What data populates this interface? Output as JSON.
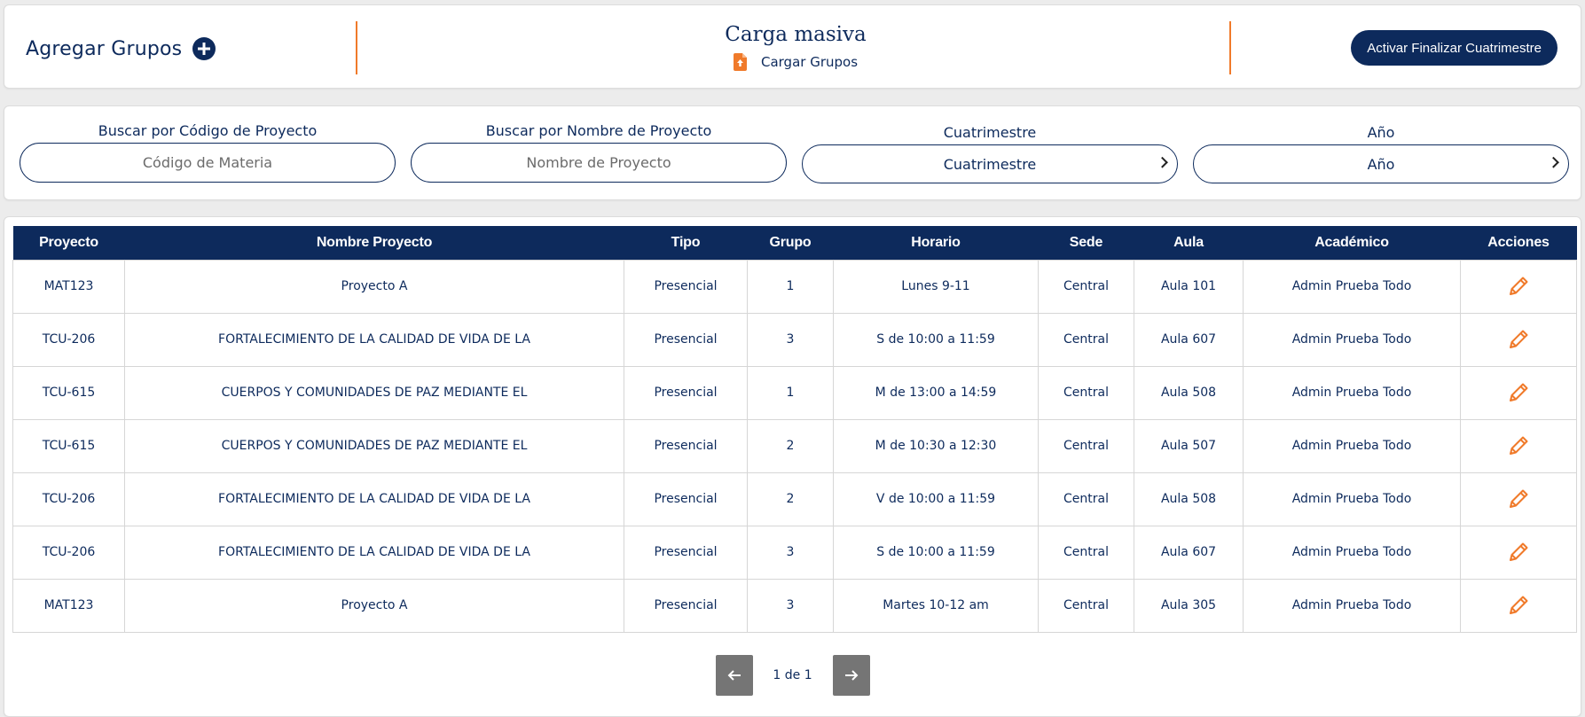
{
  "header": {
    "add_groups_label": "Agregar Grupos",
    "bulk_title": "Carga masiva",
    "bulk_link": "Cargar Grupos",
    "finalize_button": "Activar Finalizar Cuatrimestre"
  },
  "filters": {
    "code": {
      "label": "Buscar por Código de Proyecto",
      "placeholder": "Código de Materia"
    },
    "name": {
      "label": "Buscar por Nombre de Proyecto",
      "placeholder": "Nombre de Proyecto"
    },
    "term": {
      "label": "Cuatrimestre",
      "selected": "Cuatrimestre"
    },
    "year": {
      "label": "Año",
      "selected": "Año"
    }
  },
  "table": {
    "columns": [
      "Proyecto",
      "Nombre Proyecto",
      "Tipo",
      "Grupo",
      "Horario",
      "Sede",
      "Aula",
      "Académico",
      "Acciones"
    ],
    "rows": [
      [
        "MAT123",
        "Proyecto A",
        "Presencial",
        "1",
        "Lunes 9-11",
        "Central",
        "Aula 101",
        "Admin Prueba Todo"
      ],
      [
        "TCU-206",
        "FORTALECIMIENTO DE LA CALIDAD DE VIDA DE LA",
        "Presencial",
        "3",
        "S de 10:00 a 11:59",
        "Central",
        "Aula 607",
        "Admin Prueba Todo"
      ],
      [
        "TCU-615",
        "CUERPOS Y COMUNIDADES DE PAZ MEDIANTE EL",
        "Presencial",
        "1",
        "M de 13:00 a 14:59",
        "Central",
        "Aula 508",
        "Admin Prueba Todo"
      ],
      [
        "TCU-615",
        "CUERPOS Y COMUNIDADES DE PAZ MEDIANTE EL",
        "Presencial",
        "2",
        "M de 10:30 a 12:30",
        "Central",
        "Aula 507",
        "Admin Prueba Todo"
      ],
      [
        "TCU-206",
        "FORTALECIMIENTO DE LA CALIDAD DE VIDA DE LA",
        "Presencial",
        "2",
        "V de 10:00 a 11:59",
        "Central",
        "Aula 508",
        "Admin Prueba Todo"
      ],
      [
        "TCU-206",
        "FORTALECIMIENTO DE LA CALIDAD DE VIDA DE LA",
        "Presencial",
        "3",
        "S de 10:00 a 11:59",
        "Central",
        "Aula 607",
        "Admin Prueba Todo"
      ],
      [
        "MAT123",
        "Proyecto A",
        "Presencial",
        "3",
        "Martes 10-12 am",
        "Central",
        "Aula 305",
        "Admin Prueba Todo"
      ]
    ],
    "action_icon": "pencil-icon"
  },
  "pagination": {
    "text": "1 de 1",
    "prev_icon": "arrow-left-icon",
    "next_icon": "arrow-right-icon"
  },
  "colors": {
    "navy": "#0d2a5c",
    "accent": "#f07a2a",
    "pager": "#757575"
  }
}
